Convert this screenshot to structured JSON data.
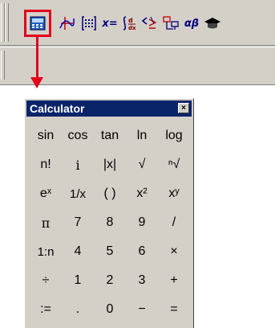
{
  "toolbar": {
    "buttons": [
      {
        "name": "calculator-toolbar-icon",
        "label": ""
      },
      {
        "name": "graph-toolbar-icon",
        "label": ""
      },
      {
        "name": "matrix-toolbar-icon",
        "label": ""
      },
      {
        "name": "evaluation-toolbar-icon",
        "label": "x="
      },
      {
        "name": "calculus-toolbar-icon",
        "label": ""
      },
      {
        "name": "boolean-toolbar-icon",
        "label": ""
      },
      {
        "name": "programming-toolbar-icon",
        "label": ""
      },
      {
        "name": "greek-toolbar-icon",
        "label": "αβ"
      },
      {
        "name": "symbolic-toolbar-icon",
        "label": ""
      }
    ]
  },
  "calculator": {
    "title": "Calculator",
    "close_label": "×",
    "rows": [
      [
        "sin",
        "cos",
        "tan",
        "ln",
        "log"
      ],
      [
        "n!",
        "i",
        "|x|",
        "√",
        "ⁿ√"
      ],
      [
        "eˣ",
        "1/x",
        "( )",
        "x²",
        "xʸ"
      ],
      [
        "π",
        "7",
        "8",
        "9",
        "/"
      ],
      [
        "1:n",
        "4",
        "5",
        "6",
        "×"
      ],
      [
        "÷",
        "1",
        "2",
        "3",
        "+"
      ],
      [
        ":=",
        ".",
        "0",
        "−",
        "="
      ]
    ]
  },
  "colors": {
    "highlight": "#e3001b",
    "title_bar": "#0a246a",
    "panel": "#d4d0c8"
  }
}
